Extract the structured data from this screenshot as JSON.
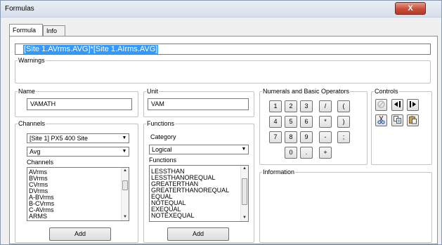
{
  "window": {
    "title": "Formulas",
    "close_label": "X"
  },
  "tabs": [
    {
      "label": "Formula"
    },
    {
      "label": "Info"
    }
  ],
  "formula": {
    "value": "[Site 1.AVrms.AVG]*[Site 1.AIrms.AVG]"
  },
  "warnings": {
    "legend": "Warnings"
  },
  "name": {
    "legend": "Name",
    "value": "VAMATH"
  },
  "unit": {
    "legend": "Unit",
    "value": "VAM"
  },
  "channels": {
    "legend": "Channels",
    "site_select": "[Site 1] PX5 400 Site",
    "stat_select": "Avg",
    "list_label": "Channels",
    "items": [
      "AVrms",
      "BVrms",
      "CVrms",
      "DVrms",
      "A-BVrms",
      "B-CVrms",
      "C-AVrms",
      "ARMS"
    ],
    "add_label": "Add"
  },
  "functions": {
    "legend": "Functions",
    "category_label": "Category",
    "category_select": "Logical",
    "list_label": "Functions",
    "items": [
      "LESSTHAN",
      "LESSTHANOREQUAL",
      "GREATERTHAN",
      "GREATERTHANOREQUAL",
      "EQUAL",
      "NOTEQUAL",
      "EXEQUAL",
      "NOTEXEQUAL"
    ],
    "add_label": "Add"
  },
  "numerals": {
    "legend": "Numerals and Basic Operators",
    "keys": [
      "1",
      "2",
      "3",
      "/",
      "(",
      "4",
      "5",
      "6",
      "*",
      ")",
      "7",
      "8",
      "9",
      "-",
      ";",
      "0",
      ".",
      "+"
    ]
  },
  "controls": {
    "legend": "Controls",
    "icons": [
      "eraser-icon",
      "move-left-icon",
      "move-right-icon",
      "cut-icon",
      "copy-icon",
      "paste-icon"
    ]
  },
  "information": {
    "legend": "Information"
  }
}
